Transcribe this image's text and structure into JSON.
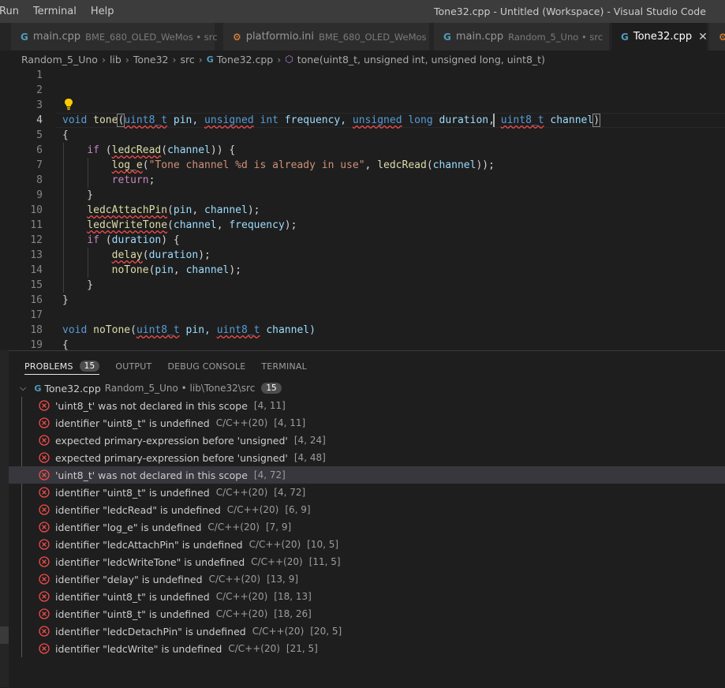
{
  "menu": {
    "items": [
      "Run",
      "Terminal",
      "Help"
    ]
  },
  "window_title": "Tone32.cpp - Untitled (Workspace) - Visual Studio Code",
  "tabs": [
    {
      "name": "main.cpp",
      "desc": "BME_680_OLED_WeMos • src",
      "icon": "cpp-file-icon"
    },
    {
      "name": "platformio.ini",
      "desc": "BME_680_OLED_WeMos",
      "icon": "platformio-icon"
    },
    {
      "name": "main.cpp",
      "desc": "Random_5_Uno • src",
      "icon": "cpp-file-icon"
    },
    {
      "name": "Tone32.cpp",
      "desc": "",
      "icon": "cpp-file-icon",
      "active": true
    }
  ],
  "breadcrumb": [
    "Random_5_Uno",
    "lib",
    "Tone32",
    "src",
    "Tone32.cpp",
    "tone(uint8_t, unsigned int, unsigned long, uint8_t)"
  ],
  "editor": {
    "line_numbers": [
      "1",
      "2",
      "3",
      "4",
      "5",
      "6",
      "7",
      "8",
      "9",
      "10",
      "11",
      "12",
      "13",
      "14",
      "15",
      "16",
      "17",
      "18",
      "19"
    ],
    "code": {
      "l4": [
        "void",
        "tone",
        "(",
        "uint8_t",
        " pin, ",
        "unsigned",
        " ",
        "int",
        " frequency, ",
        "unsigned",
        " ",
        "long",
        " duration, ",
        "uint8_t",
        " channel",
        ")"
      ],
      "l5": "{",
      "l6": [
        "    ",
        "if",
        " (",
        "ledcRead",
        "(",
        "channel",
        ")) {"
      ],
      "l7": [
        "        ",
        "log_e",
        "(",
        "\"Tone channel %d is already in use\"",
        ", ",
        "ledcRead",
        "(",
        "channel",
        "));"
      ],
      "l8": [
        "        ",
        "return",
        ";"
      ],
      "l9": "    }",
      "l10": [
        "    ",
        "ledcAttachPin",
        "(",
        "pin",
        ", ",
        "channel",
        ");"
      ],
      "l11": [
        "    ",
        "ledcWriteTone",
        "(",
        "channel",
        ", ",
        "frequency",
        ");"
      ],
      "l12": [
        "    ",
        "if",
        " (",
        "duration",
        ") {"
      ],
      "l13": [
        "        ",
        "delay",
        "(",
        "duration",
        ");"
      ],
      "l14": [
        "        ",
        "noTone",
        "(",
        "pin",
        ", ",
        "channel",
        ");"
      ],
      "l15": "    }",
      "l16": "}",
      "l18": [
        "void",
        " ",
        "noTone",
        "(",
        "uint8_t",
        " pin, ",
        "uint8_t",
        " channel)"
      ],
      "l19": "{"
    }
  },
  "panel": {
    "tabs": [
      "PROBLEMS",
      "OUTPUT",
      "DEBUG CONSOLE",
      "TERMINAL"
    ],
    "problems_count": "15",
    "file": {
      "name": "Tone32.cpp",
      "desc": "Random_5_Uno • lib\\Tone32\\src",
      "count": "15"
    },
    "problems": [
      {
        "msg": "'uint8_t' was not declared in this scope",
        "src": "",
        "loc": "[4, 11]"
      },
      {
        "msg": "identifier \"uint8_t\" is undefined",
        "src": "C/C++(20)",
        "loc": "[4, 11]"
      },
      {
        "msg": "expected primary-expression before 'unsigned'",
        "src": "",
        "loc": "[4, 24]"
      },
      {
        "msg": "expected primary-expression before 'unsigned'",
        "src": "",
        "loc": "[4, 48]"
      },
      {
        "msg": "'uint8_t' was not declared in this scope",
        "src": "",
        "loc": "[4, 72]",
        "selected": true
      },
      {
        "msg": "identifier \"uint8_t\" is undefined",
        "src": "C/C++(20)",
        "loc": "[4, 72]"
      },
      {
        "msg": "identifier \"ledcRead\" is undefined",
        "src": "C/C++(20)",
        "loc": "[6, 9]"
      },
      {
        "msg": "identifier \"log_e\" is undefined",
        "src": "C/C++(20)",
        "loc": "[7, 9]"
      },
      {
        "msg": "identifier \"ledcAttachPin\" is undefined",
        "src": "C/C++(20)",
        "loc": "[10, 5]"
      },
      {
        "msg": "identifier \"ledcWriteTone\" is undefined",
        "src": "C/C++(20)",
        "loc": "[11, 5]"
      },
      {
        "msg": "identifier \"delay\" is undefined",
        "src": "C/C++(20)",
        "loc": "[13, 9]"
      },
      {
        "msg": "identifier \"uint8_t\" is undefined",
        "src": "C/C++(20)",
        "loc": "[18, 13]"
      },
      {
        "msg": "identifier \"uint8_t\" is undefined",
        "src": "C/C++(20)",
        "loc": "[18, 26]"
      },
      {
        "msg": "identifier \"ledcDetachPin\" is undefined",
        "src": "C/C++(20)",
        "loc": "[20, 5]"
      },
      {
        "msg": "identifier \"ledcWrite\" is undefined",
        "src": "C/C++(20)",
        "loc": "[21, 5]"
      }
    ]
  },
  "colors": {
    "error": "#f14c4c",
    "keyword": "#569cd6",
    "function": "#dcdcaa",
    "variable": "#9cdcfe",
    "string": "#ce9178",
    "control": "#c586c0"
  }
}
